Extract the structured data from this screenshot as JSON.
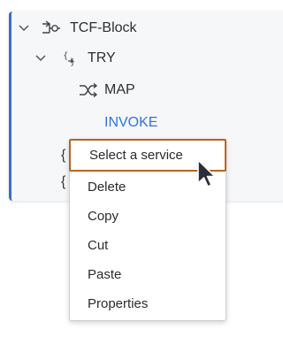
{
  "tree": {
    "items": [
      {
        "label": "TCF-Block",
        "icon": "flow-block-icon",
        "expanded": true
      },
      {
        "label": "TRY",
        "icon": "try-braces-icon",
        "expanded": true
      },
      {
        "label": "MAP",
        "icon": "shuffle-map-icon"
      },
      {
        "label": "INVOKE",
        "icon": "invoke-icon"
      }
    ],
    "peek_glyphs": [
      "{",
      "{"
    ]
  },
  "context_menu": {
    "items": [
      {
        "label": "Select a service",
        "highlighted": true
      },
      {
        "label": "Delete"
      },
      {
        "label": "Copy"
      },
      {
        "label": "Cut"
      },
      {
        "label": "Paste"
      },
      {
        "label": "Properties"
      }
    ]
  },
  "colors": {
    "accent_border": "#3a6fc4",
    "invoke_text": "#2f74e0",
    "highlight_outline": "#b8651f"
  }
}
